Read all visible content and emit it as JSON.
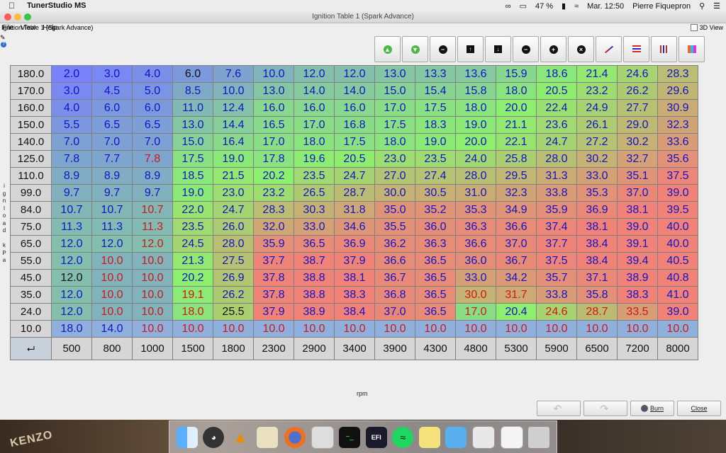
{
  "menubar": {
    "app_name": "TunerStudio MS",
    "battery": "47 %",
    "datetime": "Mar. 12:50",
    "user": "Pierre Fiquepron"
  },
  "window": {
    "title": "Ignition Table 1 (Spark Advance)",
    "menu": [
      "File",
      "View",
      "Help"
    ],
    "panel_title": "Ignition Table 1 (Spark Advance)",
    "view3d_label": "3D View"
  },
  "toolbar_icons": [
    "arrow-up-green-icon",
    "arrow-down-green-icon",
    "minus-icon",
    "up-arrow-icon",
    "down-arrow-icon",
    "decrement-icon",
    "increment-icon",
    "clear-icon",
    "interpolate-icon",
    "horizontal-interpolate-icon",
    "vertical-interpolate-icon",
    "color-scale-icon"
  ],
  "table": {
    "y_label": "ignload kPa",
    "x_label": "rpm",
    "y_bins": [
      "180.0",
      "170.0",
      "160.0",
      "150.0",
      "140.0",
      "125.0",
      "110.0",
      "99.0",
      "84.0",
      "75.0",
      "65.0",
      "55.0",
      "45.0",
      "35.0",
      "24.0",
      "10.0"
    ],
    "x_bins": [
      "500",
      "800",
      "1000",
      "1500",
      "1800",
      "2300",
      "2900",
      "3400",
      "3900",
      "4300",
      "4800",
      "5300",
      "5900",
      "6500",
      "7200",
      "8000"
    ],
    "values": [
      [
        "2.0",
        "3.0",
        "4.0",
        "6.0",
        "7.6",
        "10.0",
        "12.0",
        "12.0",
        "13.0",
        "13.3",
        "13.6",
        "15.9",
        "18.6",
        "21.4",
        "24.6",
        "28.3"
      ],
      [
        "3.0",
        "4.5",
        "5.0",
        "8.5",
        "10.0",
        "13.0",
        "14.0",
        "14.0",
        "15.0",
        "15.4",
        "15.8",
        "18.0",
        "20.5",
        "23.2",
        "26.2",
        "29.6"
      ],
      [
        "4.0",
        "6.0",
        "6.0",
        "11.0",
        "12.4",
        "16.0",
        "16.0",
        "16.0",
        "17.0",
        "17.5",
        "18.0",
        "20.0",
        "22.4",
        "24.9",
        "27.7",
        "30.9"
      ],
      [
        "5.5",
        "6.5",
        "6.5",
        "13.0",
        "14.4",
        "16.5",
        "17.0",
        "16.8",
        "17.5",
        "18.3",
        "19.0",
        "21.1",
        "23.6",
        "26.1",
        "29.0",
        "32.3"
      ],
      [
        "7.0",
        "7.0",
        "7.0",
        "15.0",
        "16.4",
        "17.0",
        "18.0",
        "17.5",
        "18.0",
        "19.0",
        "20.0",
        "22.1",
        "24.7",
        "27.2",
        "30.2",
        "33.6"
      ],
      [
        "7.8",
        "7.7",
        "7.8",
        "17.5",
        "19.0",
        "17.8",
        "19.6",
        "20.5",
        "23.0",
        "23.5",
        "24.0",
        "25.8",
        "28.0",
        "30.2",
        "32.7",
        "35.6"
      ],
      [
        "8.9",
        "8.9",
        "8.9",
        "18.5",
        "21.5",
        "20.2",
        "23.5",
        "24.7",
        "27.0",
        "27.4",
        "28.0",
        "29.5",
        "31.3",
        "33.0",
        "35.1",
        "37.5"
      ],
      [
        "9.7",
        "9.7",
        "9.7",
        "19.0",
        "23.0",
        "23.2",
        "26.5",
        "28.7",
        "30.0",
        "30.5",
        "31.0",
        "32.3",
        "33.8",
        "35.3",
        "37.0",
        "39.0"
      ],
      [
        "10.7",
        "10.7",
        "10.7",
        "22.0",
        "24.7",
        "28.3",
        "30.3",
        "31.8",
        "35.0",
        "35.2",
        "35.3",
        "34.9",
        "35.9",
        "36.9",
        "38.1",
        "39.5"
      ],
      [
        "11.3",
        "11.3",
        "11.3",
        "23.5",
        "26.0",
        "32.0",
        "33.0",
        "34.6",
        "35.5",
        "36.0",
        "36.3",
        "36.6",
        "37.4",
        "38.1",
        "39.0",
        "40.0"
      ],
      [
        "12.0",
        "12.0",
        "12.0",
        "24.5",
        "28.0",
        "35.9",
        "36.5",
        "36.9",
        "36.2",
        "36.3",
        "36.6",
        "37.0",
        "37.7",
        "38.4",
        "39.1",
        "40.0"
      ],
      [
        "12.0",
        "10.0",
        "10.0",
        "21.3",
        "27.5",
        "37.7",
        "38.7",
        "37.9",
        "36.6",
        "36.5",
        "36.0",
        "36.7",
        "37.5",
        "38.4",
        "39.4",
        "40.5"
      ],
      [
        "12.0",
        "10.0",
        "10.0",
        "20.2",
        "26.9",
        "37.8",
        "38.8",
        "38.1",
        "36.7",
        "36.5",
        "33.0",
        "34.2",
        "35.7",
        "37.1",
        "38.9",
        "40.8"
      ],
      [
        "12.0",
        "10.0",
        "10.0",
        "19.1",
        "26.2",
        "37.8",
        "38.8",
        "38.3",
        "36.8",
        "36.5",
        "30.0",
        "31.7",
        "33.8",
        "35.8",
        "38.3",
        "41.0"
      ],
      [
        "12.0",
        "10.0",
        "10.0",
        "18.0",
        "25.5",
        "37.9",
        "38.9",
        "38.4",
        "37.0",
        "36.5",
        "17.0",
        "20.4",
        "24.6",
        "28.7",
        "33.5",
        "39.0"
      ],
      [
        "18.0",
        "14.0",
        "10.0",
        "10.0",
        "10.0",
        "10.0",
        "10.0",
        "10.0",
        "10.0",
        "10.0",
        "10.0",
        "10.0",
        "10.0",
        "10.0",
        "10.0",
        "10.0"
      ]
    ],
    "text_colors": [
      [
        "b",
        "b",
        "b",
        "k",
        "b",
        "b",
        "b",
        "b",
        "b",
        "b",
        "b",
        "b",
        "b",
        "b",
        "b",
        "b"
      ],
      [
        "b",
        "b",
        "b",
        "b",
        "b",
        "b",
        "b",
        "b",
        "b",
        "b",
        "b",
        "b",
        "b",
        "b",
        "b",
        "b"
      ],
      [
        "b",
        "b",
        "b",
        "b",
        "b",
        "b",
        "b",
        "b",
        "b",
        "b",
        "b",
        "b",
        "b",
        "b",
        "b",
        "b"
      ],
      [
        "b",
        "b",
        "b",
        "b",
        "b",
        "b",
        "b",
        "b",
        "b",
        "b",
        "b",
        "b",
        "b",
        "b",
        "b",
        "b"
      ],
      [
        "b",
        "b",
        "b",
        "b",
        "b",
        "b",
        "b",
        "b",
        "b",
        "b",
        "b",
        "b",
        "b",
        "b",
        "b",
        "b"
      ],
      [
        "b",
        "b",
        "r",
        "b",
        "b",
        "b",
        "b",
        "b",
        "b",
        "b",
        "b",
        "b",
        "b",
        "b",
        "b",
        "b"
      ],
      [
        "b",
        "b",
        "b",
        "b",
        "b",
        "b",
        "b",
        "b",
        "b",
        "b",
        "b",
        "b",
        "b",
        "b",
        "b",
        "b"
      ],
      [
        "b",
        "b",
        "b",
        "b",
        "b",
        "b",
        "b",
        "b",
        "b",
        "b",
        "b",
        "b",
        "b",
        "b",
        "b",
        "b"
      ],
      [
        "b",
        "b",
        "r",
        "b",
        "b",
        "b",
        "b",
        "b",
        "b",
        "b",
        "b",
        "b",
        "b",
        "b",
        "b",
        "b"
      ],
      [
        "b",
        "b",
        "r",
        "b",
        "b",
        "b",
        "b",
        "b",
        "b",
        "b",
        "b",
        "b",
        "b",
        "b",
        "b",
        "b"
      ],
      [
        "b",
        "b",
        "r",
        "b",
        "b",
        "b",
        "b",
        "b",
        "b",
        "b",
        "b",
        "b",
        "b",
        "b",
        "b",
        "b"
      ],
      [
        "b",
        "r",
        "r",
        "b",
        "b",
        "b",
        "b",
        "b",
        "b",
        "b",
        "b",
        "b",
        "b",
        "b",
        "b",
        "b"
      ],
      [
        "k",
        "r",
        "r",
        "b",
        "b",
        "b",
        "b",
        "b",
        "b",
        "b",
        "b",
        "b",
        "b",
        "b",
        "b",
        "b"
      ],
      [
        "b",
        "r",
        "r",
        "r",
        "b",
        "b",
        "b",
        "b",
        "b",
        "b",
        "r",
        "r",
        "b",
        "b",
        "b",
        "b"
      ],
      [
        "b",
        "r",
        "r",
        "r",
        "k",
        "b",
        "b",
        "b",
        "b",
        "b",
        "r",
        "b",
        "r",
        "r",
        "r",
        "b"
      ],
      [
        "b",
        "b",
        "r",
        "r",
        "r",
        "r",
        "r",
        "r",
        "r",
        "r",
        "r",
        "r",
        "r",
        "r",
        "r",
        "r"
      ]
    ]
  },
  "buttons": {
    "undo": "",
    "redo": "",
    "burn": "Burn",
    "close": "Close"
  },
  "colors": {
    "text_blue": "#1212c8",
    "text_red": "#d41414",
    "text_black": "#111111"
  },
  "desktop": {
    "wallpaper_text": "KENZO"
  },
  "dock_icons": [
    "finder-icon",
    "dashboard-icon",
    "vlc-icon",
    "preview-icon",
    "firefox-icon",
    "script-editor-icon",
    "terminal-icon",
    "efi-analytics-icon",
    "spotify-icon",
    "stickies-icon",
    "folder-icon",
    "archive-utility-icon",
    "mail-icon",
    "trash-icon"
  ]
}
